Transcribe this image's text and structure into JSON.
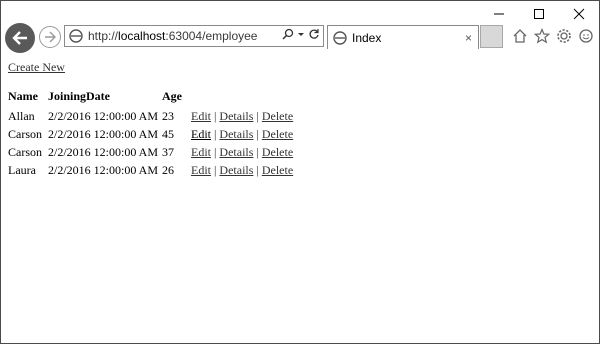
{
  "browser": {
    "url_prefix": "http://",
    "url_host": "localhost",
    "url_rest": ":63004/employee",
    "tab_title": "Index",
    "tab_close": "×"
  },
  "page": {
    "create_new": "Create New",
    "headers": [
      "Name",
      "JoiningDate",
      "Age"
    ],
    "rows": [
      {
        "name": "Allan",
        "date": "2/2/2016 12:00:00 AM",
        "age": "23"
      },
      {
        "name": "Carson",
        "date": "2/2/2016 12:00:00 AM",
        "age": "45"
      },
      {
        "name": "Carson",
        "date": "2/2/2016 12:00:00 AM",
        "age": "37"
      },
      {
        "name": "Laura",
        "date": "2/2/2016 12:00:00 AM",
        "age": "26"
      }
    ],
    "actions": {
      "edit": "Edit",
      "details": "Details",
      "delete": "Delete",
      "sep": "|"
    }
  }
}
